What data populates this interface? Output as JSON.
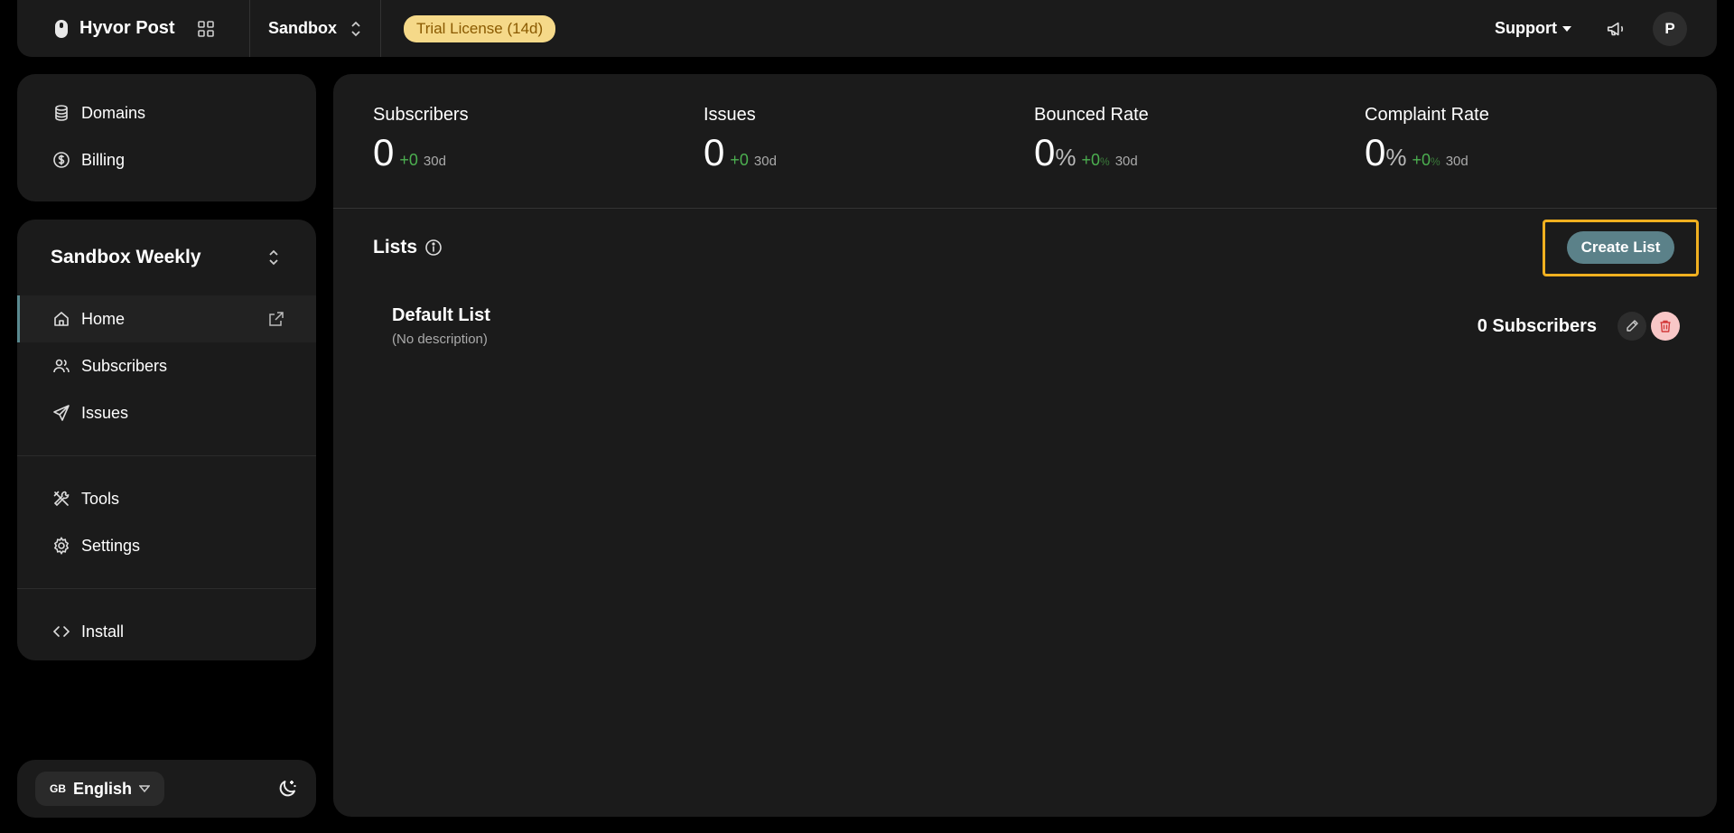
{
  "topbar": {
    "brand": "Hyvor Post",
    "project": "Sandbox",
    "trial": "Trial License (14d)",
    "support": "Support",
    "avatar_initial": "P"
  },
  "sidebar_top": {
    "items": [
      {
        "label": "Domains"
      },
      {
        "label": "Billing"
      }
    ]
  },
  "sidebar_main": {
    "newsletter": "Sandbox Weekly",
    "primary": [
      {
        "label": "Home"
      },
      {
        "label": "Subscribers"
      },
      {
        "label": "Issues"
      }
    ],
    "secondary": [
      {
        "label": "Tools"
      },
      {
        "label": "Settings"
      }
    ],
    "tertiary": [
      {
        "label": "Install"
      }
    ]
  },
  "sidebar_bottom": {
    "flag": "GB",
    "language": "English"
  },
  "stats": [
    {
      "title": "Subscribers",
      "value": "0",
      "unit": "",
      "delta": "+0",
      "delta_unit": "",
      "period": "30d"
    },
    {
      "title": "Issues",
      "value": "0",
      "unit": "",
      "delta": "+0",
      "delta_unit": "",
      "period": "30d"
    },
    {
      "title": "Bounced Rate",
      "value": "0",
      "unit": "%",
      "delta": "+0",
      "delta_unit": "%",
      "period": "30d"
    },
    {
      "title": "Complaint Rate",
      "value": "0",
      "unit": "%",
      "delta": "+0",
      "delta_unit": "%",
      "period": "30d"
    }
  ],
  "lists": {
    "title": "Lists",
    "create_label": "Create List",
    "rows": [
      {
        "name": "Default List",
        "description": "(No description)",
        "subscribers": "0 Subscribers"
      }
    ]
  },
  "colors": {
    "accent": "#5b8189",
    "highlight": "#f0b020",
    "trial_bg": "#f5d989",
    "positive": "#4caf50"
  }
}
